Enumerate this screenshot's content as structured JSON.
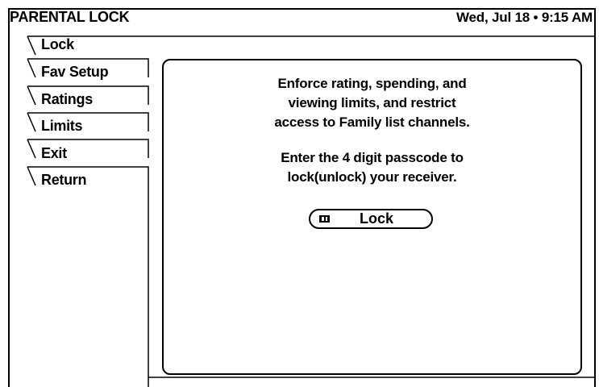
{
  "header": {
    "title": "PARENTAL LOCK",
    "datetime": "Wed, Jul 18 • 9:15 AM"
  },
  "menu": {
    "items": [
      {
        "label": "Lock",
        "selected": true
      },
      {
        "label": "Fav Setup",
        "selected": false
      },
      {
        "label": "Ratings",
        "selected": false
      },
      {
        "label": "Limits",
        "selected": false
      },
      {
        "label": "Exit",
        "selected": false
      },
      {
        "label": "Return",
        "selected": false
      }
    ]
  },
  "panel": {
    "description_lines": [
      "Enforce rating, spending, and",
      "viewing limits, and restrict",
      "access to Family list channels."
    ],
    "instruction_lines": [
      "Enter the 4 digit passcode to",
      "lock(unlock) your receiver."
    ],
    "button_label": "Lock",
    "button_icon": "remote-key-icon"
  }
}
